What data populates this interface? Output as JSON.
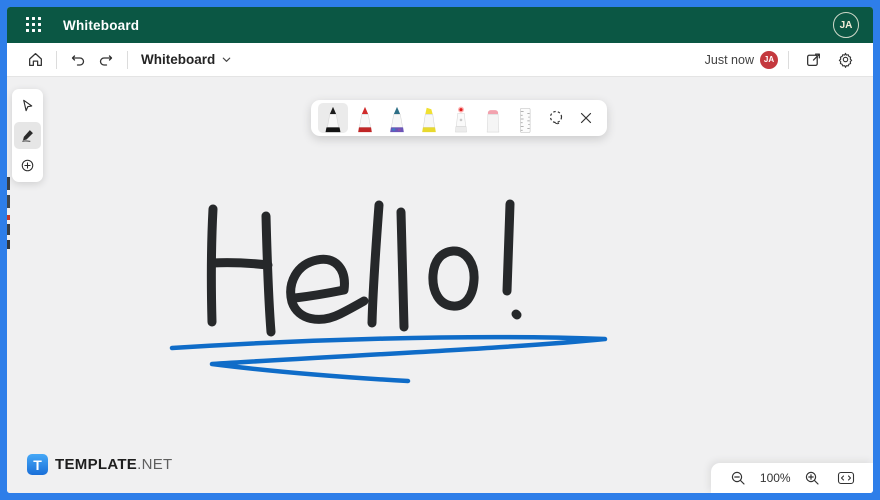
{
  "header": {
    "title": "Whiteboard",
    "avatar_initials": "JA"
  },
  "menubar": {
    "board_title": "Whiteboard",
    "last_saved": "Just now",
    "saved_by_initials": "JA"
  },
  "left_toolbar": {
    "tools": [
      "select",
      "ink-pen",
      "add"
    ],
    "active_tool": "ink-pen"
  },
  "pen_toolbar": {
    "tools": [
      "black-pen",
      "red-pen",
      "galaxy-pen",
      "yellow-highlighter",
      "laser-pointer",
      "eraser",
      "ruler"
    ],
    "selected_tool": "black-pen",
    "actions": [
      "lasso-select",
      "close"
    ]
  },
  "canvas": {
    "handwriting": "Hello!",
    "ink_black": "#26282a",
    "ink_blue": "#0f6cc8"
  },
  "branding": {
    "logo_letter": "T",
    "name_bold": "TEMPLATE",
    "name_light": ".NET"
  },
  "zoom_controls": {
    "level": "100%"
  },
  "colors": {
    "header_bg": "#0b5744",
    "frame": "#2e7ee9",
    "canvas_bg": "#f0f0f1",
    "badge_red": "#c4383e",
    "brand_blue": "#1a6fd8"
  }
}
